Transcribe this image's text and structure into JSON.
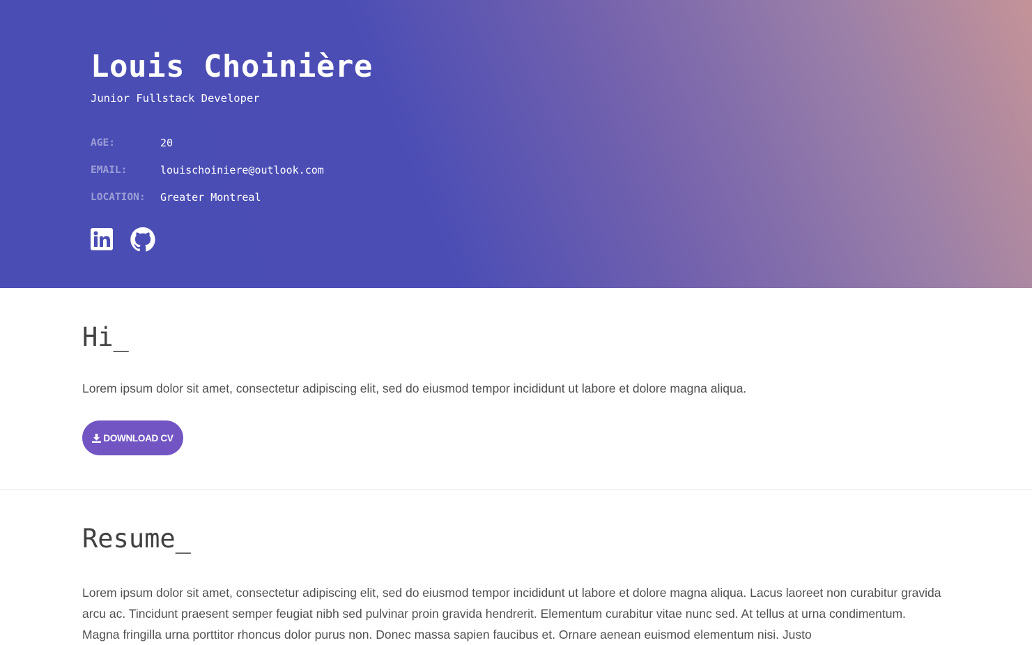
{
  "header": {
    "name": "Louis Choinière",
    "subtitle": "Junior Fullstack Developer",
    "info": [
      {
        "label": "AGE:",
        "value": "20"
      },
      {
        "label": "EMAIL:",
        "value": "louischoiniere@outlook.com"
      },
      {
        "label": "LOCATION:",
        "value": "Greater Montreal"
      }
    ],
    "social": [
      {
        "icon": "linkedin-icon"
      },
      {
        "icon": "github-icon"
      }
    ],
    "gradient_colors": [
      "#4a4db4",
      "#7563ad",
      "#c49398"
    ]
  },
  "intro": {
    "title": "Hi_",
    "text": "Lorem ipsum dolor sit amet, consectetur adipiscing elit, sed do eiusmod tempor incididunt ut labore et dolore magna aliqua.",
    "download_label": "DOWNLOAD CV",
    "download_icon": "download-icon",
    "button_color": "#7255c3"
  },
  "resume": {
    "title": "Resume_",
    "text": "Lorem ipsum dolor sit amet, consectetur adipiscing elit, sed do eiusmod tempor incididunt ut labore et dolore magna aliqua. Lacus laoreet non curabitur gravida arcu ac. Tincidunt praesent semper feugiat nibh sed pulvinar proin gravida hendrerit. Elementum curabitur vitae nunc sed. At tellus at urna condimentum. Magna fringilla urna porttitor rhoncus dolor purus non. Donec massa sapien faucibus et. Ornare aenean euismod elementum nisi. Justo"
  }
}
